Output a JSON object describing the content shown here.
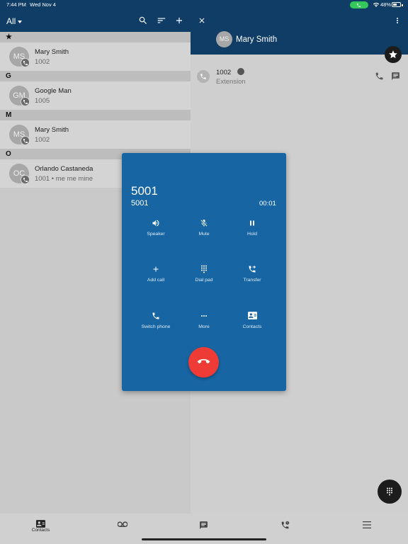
{
  "status_bar": {
    "time": "7:44 PM",
    "date": "Wed Nov 4",
    "battery": "48%"
  },
  "left_header": {
    "filter": "All"
  },
  "contacts": {
    "sections": [
      {
        "letter": "★",
        "rows": [
          {
            "initials": "MS",
            "name": "Mary Smith",
            "sub": "1002"
          }
        ]
      },
      {
        "letter": "G",
        "rows": [
          {
            "initials": "GM",
            "name": "Google Man",
            "sub": "1005"
          }
        ]
      },
      {
        "letter": "M",
        "rows": [
          {
            "initials": "MS",
            "name": "Mary Smith",
            "sub": "1002"
          }
        ]
      },
      {
        "letter": "O",
        "rows": [
          {
            "initials": "OC",
            "name": "Orlando Castaneda",
            "sub": "1001 • me me mine"
          }
        ]
      }
    ]
  },
  "detail": {
    "initials": "MS",
    "name": "Mary Smith",
    "ext_number": "1002",
    "ext_label": "Extension"
  },
  "call": {
    "title": "5001",
    "number": "5001",
    "timer": "00:01",
    "controls": [
      "Speaker",
      "Mute",
      "Hold",
      "Add call",
      "Dial pad",
      "Transfer",
      "Switch phone",
      "More",
      "Contacts"
    ]
  },
  "bottom_nav": {
    "contacts_label": "Contacts"
  },
  "colors": {
    "header": "#0f3d66",
    "dialog": "#1766a3",
    "hangup": "#ef3b36",
    "call_pill": "#34c759"
  },
  "icons": [
    "search-icon",
    "sort-icon",
    "add-icon",
    "close-icon",
    "more-vert-icon",
    "star-icon",
    "phone-icon",
    "message-icon",
    "speaker-icon",
    "mic-off-icon",
    "pause-icon",
    "add-call-icon",
    "dialpad-icon",
    "transfer-icon",
    "switch-phone-icon",
    "more-icon",
    "contact-card-icon",
    "hangup-icon",
    "voicemail-icon",
    "recents-icon",
    "menu-icon"
  ]
}
